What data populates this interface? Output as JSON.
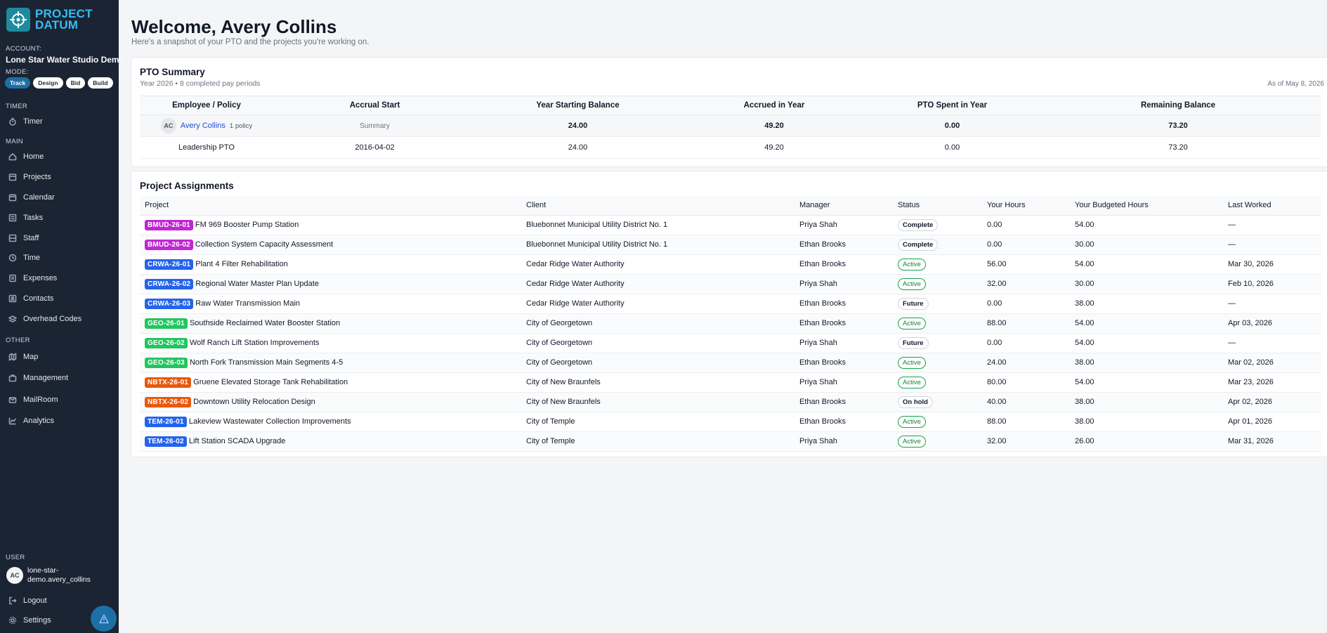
{
  "app": {
    "logo_line1": "PROJECT",
    "logo_line2": "DATUM",
    "brand_color": "#38bdf8",
    "sidebar_bg": "#1b2433"
  },
  "sidebar": {
    "account_label": "ACCOUNT:",
    "account_name": "Lone Star Water Studio Demo",
    "mode_label": "MODE:",
    "modes": [
      "Track",
      "Design",
      "Bid",
      "Build"
    ],
    "active_mode": "Track",
    "timer_section": "TIMER",
    "timer_item": "Timer",
    "main_section": "MAIN",
    "main_items": [
      "Home",
      "Projects",
      "Calendar",
      "Tasks",
      "Staff",
      "Time",
      "Expenses",
      "Contacts",
      "Overhead Codes"
    ],
    "other_section": "OTHER",
    "other_items": [
      "Map",
      "Management",
      "MailRoom",
      "Analytics"
    ],
    "user_section": "USER",
    "user_initials": "AC",
    "user_name": "lone-star-demo.avery_collins",
    "logout": "Logout",
    "settings": "Settings"
  },
  "header": {
    "title": "Welcome, Avery Collins",
    "subtitle": "Here's a snapshot of your PTO and the projects you're working on."
  },
  "pto": {
    "title": "PTO Summary",
    "subtitle": "Year 2026 • 8 completed pay periods",
    "as_of": "As of May 8, 2026",
    "columns": [
      "Employee / Policy",
      "Accrual Start",
      "Year Starting Balance",
      "Accrued in Year",
      "PTO Spent in Year",
      "Remaining Balance"
    ],
    "summary": {
      "initials": "AC",
      "employee": "Avery Collins",
      "policy_count": "1 policy",
      "accrual_start": "Summary",
      "start_balance": "24.00",
      "accrued": "49.20",
      "spent": "0.00",
      "remaining": "73.20"
    },
    "rows": [
      {
        "policy": "Leadership PTO",
        "accrual_start": "2016-04-02",
        "start_balance": "24.00",
        "accrued": "49.20",
        "spent": "0.00",
        "remaining": "73.20"
      }
    ]
  },
  "projects": {
    "title": "Project Assignments",
    "columns": [
      "Project",
      "Client",
      "Manager",
      "Status",
      "Your Hours",
      "Your Budgeted Hours",
      "Last Worked"
    ],
    "rows": [
      {
        "code": "BMUD-26-01",
        "color": "#c026d3",
        "name": "FM 969 Booster Pump Station",
        "client": "Bluebonnet Municipal Utility District No. 1",
        "manager": "Priya Shah",
        "status": "Complete",
        "hours": "0.00",
        "budget": "54.00",
        "last": "—"
      },
      {
        "code": "BMUD-26-02",
        "color": "#c026d3",
        "name": "Collection System Capacity Assessment",
        "client": "Bluebonnet Municipal Utility District No. 1",
        "manager": "Ethan Brooks",
        "status": "Complete",
        "hours": "0.00",
        "budget": "30.00",
        "last": "—"
      },
      {
        "code": "CRWA-26-01",
        "color": "#2563eb",
        "name": "Plant 4 Filter Rehabilitation",
        "client": "Cedar Ridge Water Authority",
        "manager": "Ethan Brooks",
        "status": "Active",
        "hours": "56.00",
        "budget": "54.00",
        "last": "Mar 30, 2026"
      },
      {
        "code": "CRWA-26-02",
        "color": "#2563eb",
        "name": "Regional Water Master Plan Update",
        "client": "Cedar Ridge Water Authority",
        "manager": "Priya Shah",
        "status": "Active",
        "hours": "32.00",
        "budget": "30.00",
        "last": "Feb 10, 2026"
      },
      {
        "code": "CRWA-26-03",
        "color": "#2563eb",
        "name": "Raw Water Transmission Main",
        "client": "Cedar Ridge Water Authority",
        "manager": "Ethan Brooks",
        "status": "Future",
        "hours": "0.00",
        "budget": "38.00",
        "last": "—"
      },
      {
        "code": "GEO-26-01",
        "color": "#22c55e",
        "name": "Southside Reclaimed Water Booster Station",
        "client": "City of Georgetown",
        "manager": "Ethan Brooks",
        "status": "Active",
        "hours": "88.00",
        "budget": "54.00",
        "last": "Apr 03, 2026"
      },
      {
        "code": "GEO-26-02",
        "color": "#22c55e",
        "name": "Wolf Ranch Lift Station Improvements",
        "client": "City of Georgetown",
        "manager": "Priya Shah",
        "status": "Future",
        "hours": "0.00",
        "budget": "54.00",
        "last": "—"
      },
      {
        "code": "GEO-26-03",
        "color": "#22c55e",
        "name": "North Fork Transmission Main Segments 4-5",
        "client": "City of Georgetown",
        "manager": "Ethan Brooks",
        "status": "Active",
        "hours": "24.00",
        "budget": "38.00",
        "last": "Mar 02, 2026"
      },
      {
        "code": "NBTX-26-01",
        "color": "#ea580c",
        "name": "Gruene Elevated Storage Tank Rehabilitation",
        "client": "City of New Braunfels",
        "manager": "Priya Shah",
        "status": "Active",
        "hours": "80.00",
        "budget": "54.00",
        "last": "Mar 23, 2026"
      },
      {
        "code": "NBTX-26-02",
        "color": "#ea580c",
        "name": "Downtown Utility Relocation Design",
        "client": "City of New Braunfels",
        "manager": "Ethan Brooks",
        "status": "On hold",
        "hours": "40.00",
        "budget": "38.00",
        "last": "Apr 02, 2026"
      },
      {
        "code": "TEM-26-01",
        "color": "#2563eb",
        "name": "Lakeview Wastewater Collection Improvements",
        "client": "City of Temple",
        "manager": "Ethan Brooks",
        "status": "Active",
        "hours": "88.00",
        "budget": "38.00",
        "last": "Apr 01, 2026"
      },
      {
        "code": "TEM-26-02",
        "color": "#2563eb",
        "name": "Lift Station SCADA Upgrade",
        "client": "City of Temple",
        "manager": "Priya Shah",
        "status": "Active",
        "hours": "32.00",
        "budget": "26.00",
        "last": "Mar 31, 2026"
      }
    ]
  }
}
